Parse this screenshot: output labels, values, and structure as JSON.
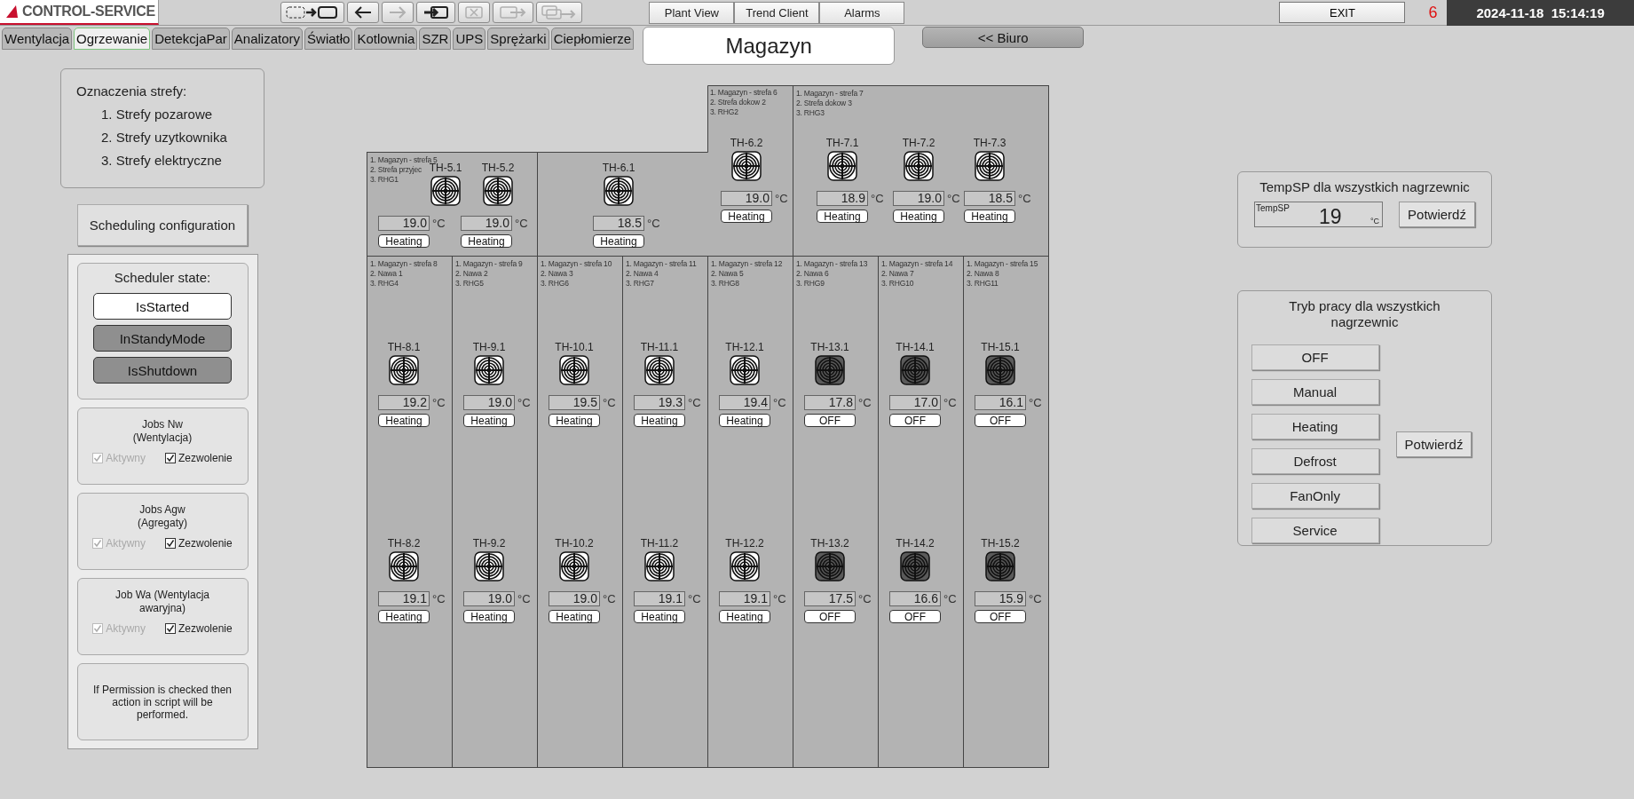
{
  "header": {
    "logo": "CONTROL-SERVICE",
    "toolbar": [
      {
        "kind": "select-box",
        "disabled": false
      },
      {
        "kind": "back",
        "disabled": false
      },
      {
        "kind": "forward",
        "disabled": true
      },
      {
        "kind": "enter",
        "disabled": false
      },
      {
        "kind": "delete",
        "disabled": true
      },
      {
        "kind": "export",
        "disabled": true
      },
      {
        "kind": "copy",
        "disabled": true
      }
    ],
    "nav": [
      "Plant View",
      "Trend Client",
      "Alarms"
    ],
    "exit": "EXIT",
    "alarm_count": "6",
    "datetime": "2024-11-18  15:14:19"
  },
  "tabs": [
    {
      "label": "Wentylacja",
      "selected": false
    },
    {
      "label": "Ogrzewanie",
      "selected": true
    },
    {
      "label": "DetekcjaPar",
      "selected": false
    },
    {
      "label": "Analizatory",
      "selected": false
    },
    {
      "label": "Światło",
      "selected": false
    },
    {
      "label": "Kotlownia",
      "selected": false
    },
    {
      "label": "SZR",
      "selected": false
    },
    {
      "label": "UPS",
      "selected": false
    },
    {
      "label": "Sprężarki",
      "selected": false
    },
    {
      "label": "Ciepłomierze",
      "selected": false
    }
  ],
  "title": "Magazyn",
  "back_button": "<< Biuro",
  "legend": {
    "title": "Oznaczenia strefy:",
    "items": [
      "1. Strefy pozarowe",
      "2. Strefy uzytkownika",
      "3. Strefy elektryczne"
    ]
  },
  "scheduling_button": "Scheduling configuration",
  "scheduler": {
    "title": "Scheduler state:",
    "states": [
      {
        "label": "IsStarted",
        "active": true
      },
      {
        "label": "InStandyMode",
        "active": false
      },
      {
        "label": "IsShutdown",
        "active": false
      }
    ],
    "jobs": [
      {
        "title_lines": [
          "Jobs Nw",
          "(Wentylacja)"
        ],
        "checks": [
          {
            "label": "Aktywny",
            "checked": true,
            "disabled": true
          },
          {
            "label": "Zezwolenie",
            "checked": true,
            "disabled": false
          }
        ]
      },
      {
        "title_lines": [
          "Jobs Agw",
          "(Agregaty)"
        ],
        "checks": [
          {
            "label": "Aktywny",
            "checked": true,
            "disabled": true
          },
          {
            "label": "Zezwolenie",
            "checked": true,
            "disabled": false
          }
        ]
      },
      {
        "title_lines": [
          "Job Wa (Wentylacja",
          "awaryjna)"
        ],
        "checks": [
          {
            "label": "Aktywny",
            "checked": true,
            "disabled": true
          },
          {
            "label": "Zezwolenie",
            "checked": true,
            "disabled": false
          }
        ]
      }
    ],
    "note": "If Permission is checked then action in script will be performed."
  },
  "zones": [
    {
      "lines": [
        "1. Magazyn - strefa 5",
        "2. Strefa przyjec",
        "3. RHG1"
      ],
      "heaters": [
        {
          "tag": "TH-5.1",
          "temp": "19.0",
          "unit": "°C",
          "mode": "Heating",
          "running": true
        },
        {
          "tag": "TH-5.2",
          "temp": "19.0",
          "unit": "°C",
          "mode": "Heating",
          "running": true
        }
      ]
    },
    {
      "lines": [
        "1. Magazyn - strefa 6",
        "2. Strefa dokow 2",
        "3. RHG2"
      ],
      "heaters": [
        {
          "tag": "TH-6.1",
          "temp": "18.5",
          "unit": "°C",
          "mode": "Heating",
          "running": true
        },
        {
          "tag": "TH-6.2",
          "temp": "19.0",
          "unit": "°C",
          "mode": "Heating",
          "running": true
        }
      ]
    },
    {
      "lines": [
        "1. Magazyn - strefa 7",
        "2. Strefa dokow 3",
        "3. RHG3"
      ],
      "heaters": [
        {
          "tag": "TH-7.1",
          "temp": "18.9",
          "unit": "°C",
          "mode": "Heating",
          "running": true
        },
        {
          "tag": "TH-7.2",
          "temp": "19.0",
          "unit": "°C",
          "mode": "Heating",
          "running": true
        },
        {
          "tag": "TH-7.3",
          "temp": "18.5",
          "unit": "°C",
          "mode": "Heating",
          "running": true
        }
      ]
    },
    {
      "lines": [
        "1. Magazyn - strefa 8",
        "2. Nawa 1",
        "3. RHG4"
      ],
      "heaters": [
        {
          "tag": "TH-8.1",
          "temp": "19.2",
          "unit": "°C",
          "mode": "Heating",
          "running": true
        },
        {
          "tag": "TH-8.2",
          "temp": "19.1",
          "unit": "°C",
          "mode": "Heating",
          "running": true
        }
      ]
    },
    {
      "lines": [
        "1. Magazyn - strefa 9",
        "2. Nawa 2",
        "3. RHG5"
      ],
      "heaters": [
        {
          "tag": "TH-9.1",
          "temp": "19.0",
          "unit": "°C",
          "mode": "Heating",
          "running": true
        },
        {
          "tag": "TH-9.2",
          "temp": "19.0",
          "unit": "°C",
          "mode": "Heating",
          "running": true
        }
      ]
    },
    {
      "lines": [
        "1. Magazyn - strefa 10",
        "2. Nawa 3",
        "3. RHG6"
      ],
      "heaters": [
        {
          "tag": "TH-10.1",
          "temp": "19.5",
          "unit": "°C",
          "mode": "Heating",
          "running": true
        },
        {
          "tag": "TH-10.2",
          "temp": "19.0",
          "unit": "°C",
          "mode": "Heating",
          "running": true
        }
      ]
    },
    {
      "lines": [
        "1. Magazyn - strefa 11",
        "2. Nawa 4",
        "3. RHG7"
      ],
      "heaters": [
        {
          "tag": "TH-11.1",
          "temp": "19.3",
          "unit": "°C",
          "mode": "Heating",
          "running": true
        },
        {
          "tag": "TH-11.2",
          "temp": "19.1",
          "unit": "°C",
          "mode": "Heating",
          "running": true
        }
      ]
    },
    {
      "lines": [
        "1. Magazyn - strefa 12",
        "2. Nawa 5",
        "3. RHG8"
      ],
      "heaters": [
        {
          "tag": "TH-12.1",
          "temp": "19.4",
          "unit": "°C",
          "mode": "Heating",
          "running": true
        },
        {
          "tag": "TH-12.2",
          "temp": "19.1",
          "unit": "°C",
          "mode": "Heating",
          "running": true
        }
      ]
    },
    {
      "lines": [
        "1. Magazyn - strefa 13",
        "2. Nawa 6",
        "3. RHG9"
      ],
      "heaters": [
        {
          "tag": "TH-13.1",
          "temp": "17.8",
          "unit": "°C",
          "mode": "OFF",
          "running": false
        },
        {
          "tag": "TH-13.2",
          "temp": "17.5",
          "unit": "°C",
          "mode": "OFF",
          "running": false
        }
      ]
    },
    {
      "lines": [
        "1. Magazyn - strefa 14",
        "2. Nawa 7",
        "3. RHG10"
      ],
      "heaters": [
        {
          "tag": "TH-14.1",
          "temp": "17.0",
          "unit": "°C",
          "mode": "OFF",
          "running": false
        },
        {
          "tag": "TH-14.2",
          "temp": "16.6",
          "unit": "°C",
          "mode": "OFF",
          "running": false
        }
      ]
    },
    {
      "lines": [
        "1. Magazyn - strefa 15",
        "2. Nawa 8",
        "3. RHG11"
      ],
      "heaters": [
        {
          "tag": "TH-15.1",
          "temp": "16.1",
          "unit": "°C",
          "mode": "OFF",
          "running": false
        },
        {
          "tag": "TH-15.2",
          "temp": "15.9",
          "unit": "°C",
          "mode": "OFF",
          "running": false
        }
      ]
    }
  ],
  "tempsp": {
    "title": "TempSP dla wszystkich nagrzewnic",
    "label": "TempSP",
    "value": "19",
    "unit": "°C",
    "confirm": "Potwierdź"
  },
  "mode_panel": {
    "title": "Tryb pracy dla wszystkich nagrzewnic",
    "modes": [
      "OFF",
      "Manual",
      "Heating",
      "Defrost",
      "FanOnly",
      "Service"
    ],
    "confirm": "Potwierdź"
  }
}
